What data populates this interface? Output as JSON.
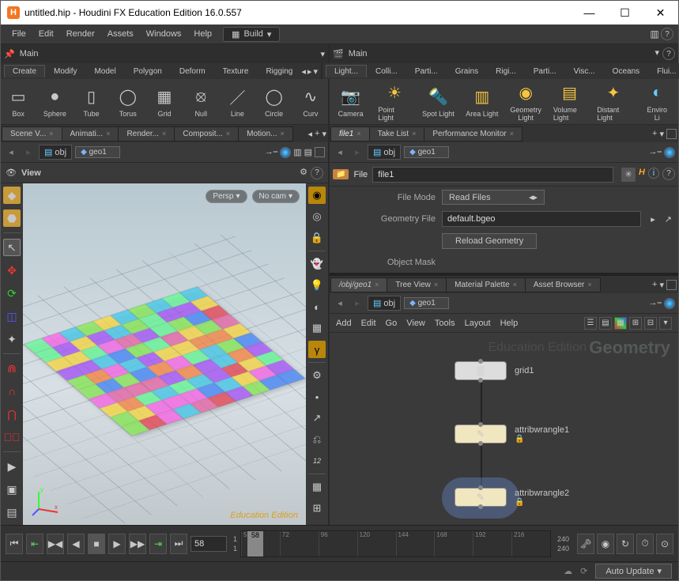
{
  "title": "untitled.hip - Houdini FX Education Edition 16.0.557",
  "menubar": {
    "items": [
      "File",
      "Edit",
      "Render",
      "Assets",
      "Windows",
      "Help"
    ],
    "layout": "Build"
  },
  "desktop_tabs": {
    "left": "Main",
    "right": "Main"
  },
  "shelf": {
    "tabs_left": [
      "Create",
      "Modify",
      "Model",
      "Polygon",
      "Deform",
      "Texture",
      "Rigging"
    ],
    "tools_left": [
      {
        "icon": "▭",
        "label": "Box"
      },
      {
        "icon": "●",
        "label": "Sphere"
      },
      {
        "icon": "▯",
        "label": "Tube"
      },
      {
        "icon": "◯",
        "label": "Torus"
      },
      {
        "icon": "▦",
        "label": "Grid"
      },
      {
        "icon": "⦻",
        "label": "Null"
      },
      {
        "icon": "／",
        "label": "Line"
      },
      {
        "icon": "◯",
        "label": "Circle"
      },
      {
        "icon": "∿",
        "label": "Curv"
      }
    ],
    "tabs_right": [
      "Light...",
      "Colli...",
      "Parti...",
      "Grains",
      "Rigi...",
      "Parti...",
      "Visc...",
      "Oceans",
      "Flui..."
    ],
    "tools_right": [
      {
        "icon": "📷",
        "label": "Camera"
      },
      {
        "icon": "☀",
        "label": "Point Light"
      },
      {
        "icon": "🔦",
        "label": "Spot Light"
      },
      {
        "icon": "▥",
        "label": "Area Light"
      },
      {
        "icon": "◉",
        "label": "Geometry\nLight"
      },
      {
        "icon": "▤",
        "label": "Volume Light"
      },
      {
        "icon": "✦",
        "label": "Distant Light"
      },
      {
        "icon": "◐",
        "label": "Enviro\nLi"
      }
    ]
  },
  "left_panel": {
    "tabs": [
      "Scene V...",
      "Animati...",
      "Render...",
      "Composit...",
      "Motion..."
    ],
    "path": {
      "type": "obj",
      "node": "geo1"
    },
    "view_label": "View",
    "vp": {
      "persp": "Persp",
      "cam": "No cam"
    },
    "watermark": "Education Edition"
  },
  "right_top": {
    "tabs": [
      "file1",
      "Take List",
      "Performance Monitor"
    ],
    "path": {
      "type": "obj",
      "node": "geo1"
    },
    "file_label": "File",
    "node_name": "file1",
    "parms": {
      "file_mode_label": "File Mode",
      "file_mode_value": "Read Files",
      "geom_file_label": "Geometry File",
      "geom_file_value": "default.bgeo",
      "reload_label": "Reload Geometry",
      "obj_mask_label": "Object Mask",
      "obj_mask_value": ""
    }
  },
  "right_net": {
    "tabs": [
      "/obj/geo1",
      "Tree View",
      "Material Palette",
      "Asset Browser"
    ],
    "path": {
      "type": "obj",
      "node": "geo1"
    },
    "menu": [
      "Add",
      "Edit",
      "Go",
      "View",
      "Tools",
      "Layout",
      "Help"
    ],
    "wm_label": "Geometry",
    "wm_ed": "Education Edition",
    "nodes": {
      "n1": "grid1",
      "n2": "attribwrangle1",
      "n3": "attribwrangle2"
    }
  },
  "timeline": {
    "cur": "58",
    "start": "1",
    "sub": "1",
    "end": "240",
    "end2": "240",
    "ticks": [
      "58",
      "72",
      "96",
      "120",
      "144",
      "168",
      "192",
      "216"
    ]
  },
  "footer": {
    "auto": "Auto Update"
  }
}
